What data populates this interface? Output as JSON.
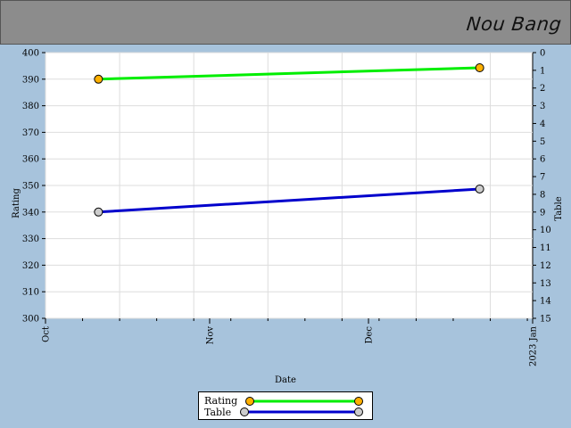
{
  "header": {
    "title": "Nou Bang",
    "bg_color": "#8c8c8c"
  },
  "chart_data": {
    "type": "line",
    "title": "Nou Bang",
    "xlabel": "Date",
    "ylabel": "Rating",
    "y2label": "Table",
    "x_ticks": [
      "Oct",
      "Nov",
      "Dec",
      "2023 Jan"
    ],
    "xlim": [
      "2022-10-01",
      "2023-01-01"
    ],
    "ylim": [
      300,
      400
    ],
    "y_ticks": [
      300,
      310,
      320,
      330,
      340,
      350,
      360,
      370,
      380,
      390,
      400
    ],
    "y2lim": [
      0,
      15
    ],
    "y2_inverted": true,
    "y2_ticks": [
      0,
      1,
      2,
      3,
      4,
      5,
      6,
      7,
      8,
      9,
      10,
      11,
      12,
      13,
      14,
      15
    ],
    "grid": true,
    "legend_position": "bottom-center",
    "series": [
      {
        "name": "Rating",
        "axis": "left",
        "color": "#00ee00",
        "marker_color": "#ffb000",
        "points": [
          {
            "x": "2022-10-11",
            "y": 390
          },
          {
            "x": "2022-12-22",
            "y": 394.3
          }
        ]
      },
      {
        "name": "Table",
        "axis": "right",
        "color": "#0000cc",
        "marker_color": "#cccccc",
        "points": [
          {
            "x": "2022-10-11",
            "y": 9
          },
          {
            "x": "2022-12-22",
            "y": 7.7
          }
        ]
      }
    ]
  }
}
